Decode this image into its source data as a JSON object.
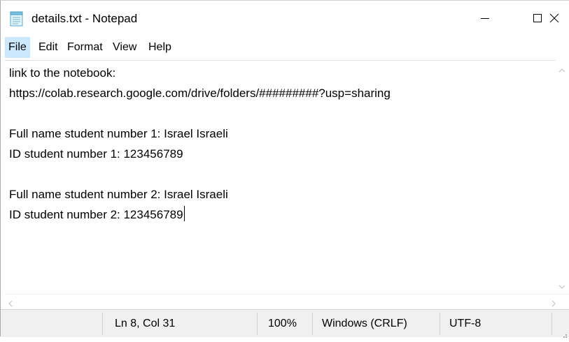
{
  "window": {
    "title": "details.txt - Notepad",
    "icons": {
      "app": "notepad-icon",
      "minimize": "minimize-icon",
      "maximize": "maximize-icon",
      "close": "close-icon"
    }
  },
  "menu": {
    "items": [
      {
        "label": "File",
        "active": true
      },
      {
        "label": "Edit"
      },
      {
        "label": "Format"
      },
      {
        "label": "View"
      },
      {
        "label": "Help"
      }
    ]
  },
  "editor": {
    "lines": [
      "link to the notebook:",
      "https://colab.research.google.com/drive/folders/#########?usp=sharing",
      "",
      "Full name student number 1: Israel Israeli",
      "ID student number 1: 123456789",
      "",
      "Full name student number 2: Israel Israeli",
      "ID student number 2: 123456789"
    ],
    "caret": {
      "line": 8,
      "column": 31
    }
  },
  "status": {
    "position": "Ln 8, Col 31",
    "zoom": "100%",
    "line_endings": "Windows (CRLF)",
    "encoding": "UTF-8"
  },
  "colors": {
    "active_menu": "#cce8ff",
    "status_bar": "#f0f0f0"
  }
}
